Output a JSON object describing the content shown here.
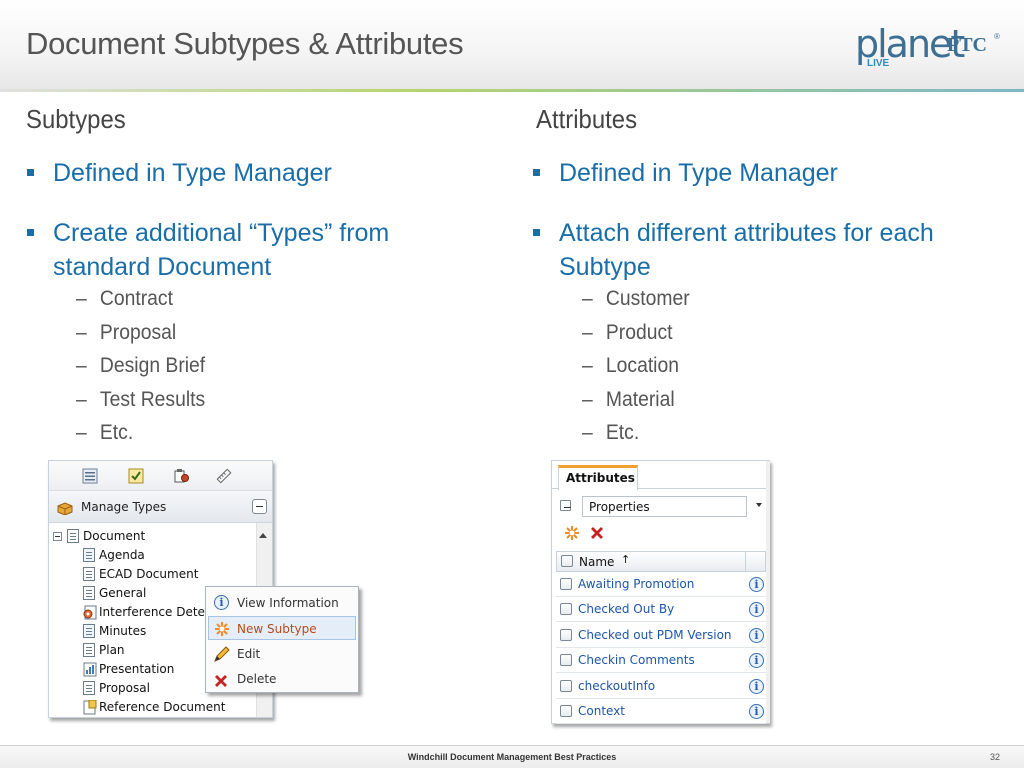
{
  "slide": {
    "title": "Document Subtypes & Attributes",
    "logo": {
      "planet": "planet",
      "ptc": "PTC",
      "reg": "®",
      "live": "LIVE"
    }
  },
  "left_column": {
    "heading": "Subtypes",
    "bullets": [
      "Defined in Type Manager",
      "Create additional “Types” from standard Document"
    ],
    "sub_items": [
      "Contract",
      "Proposal",
      "Design Brief",
      "Test Results",
      "Etc."
    ]
  },
  "right_column": {
    "heading": "Attributes",
    "bullets": [
      "Defined in Type Manager",
      "Attach different attributes for each Subtype"
    ],
    "sub_items": [
      "Customer",
      "Product",
      "Location",
      "Material",
      "Etc."
    ]
  },
  "manage_types_panel": {
    "header_label": "Manage Types",
    "root": "Document",
    "tree_items": [
      "Agenda",
      "ECAD Document",
      "General",
      "Interference Detect",
      "Minutes",
      "Plan",
      "Presentation",
      "Proposal",
      "Reference Document"
    ],
    "context_menu": [
      {
        "label": "View Information",
        "icon": "info-icon",
        "highlighted": false
      },
      {
        "label": "New Subtype",
        "icon": "new-subtype-icon",
        "highlighted": true
      },
      {
        "label": "Edit",
        "icon": "pencil-icon",
        "highlighted": false
      },
      {
        "label": "Delete",
        "icon": "delete-icon",
        "highlighted": false
      }
    ]
  },
  "attributes_panel": {
    "tab_label": "Attributes",
    "select_value": "Properties",
    "column_header": "Name",
    "sort_indicator": "↑",
    "rows": [
      "Awaiting Promotion",
      "Checked Out By",
      "Checked out PDM Version",
      "Checkin Comments",
      "checkoutInfo",
      "Context"
    ]
  },
  "footer": {
    "center_text": "Windchill Document Management Best Practices",
    "page_number": "32"
  },
  "colors": {
    "bullet_blue": "#1a6ea8",
    "title_gray": "#555555",
    "brand_blue": "#3d6f92",
    "tab_accent": "#f0a030",
    "link_blue": "#1d55a8"
  }
}
